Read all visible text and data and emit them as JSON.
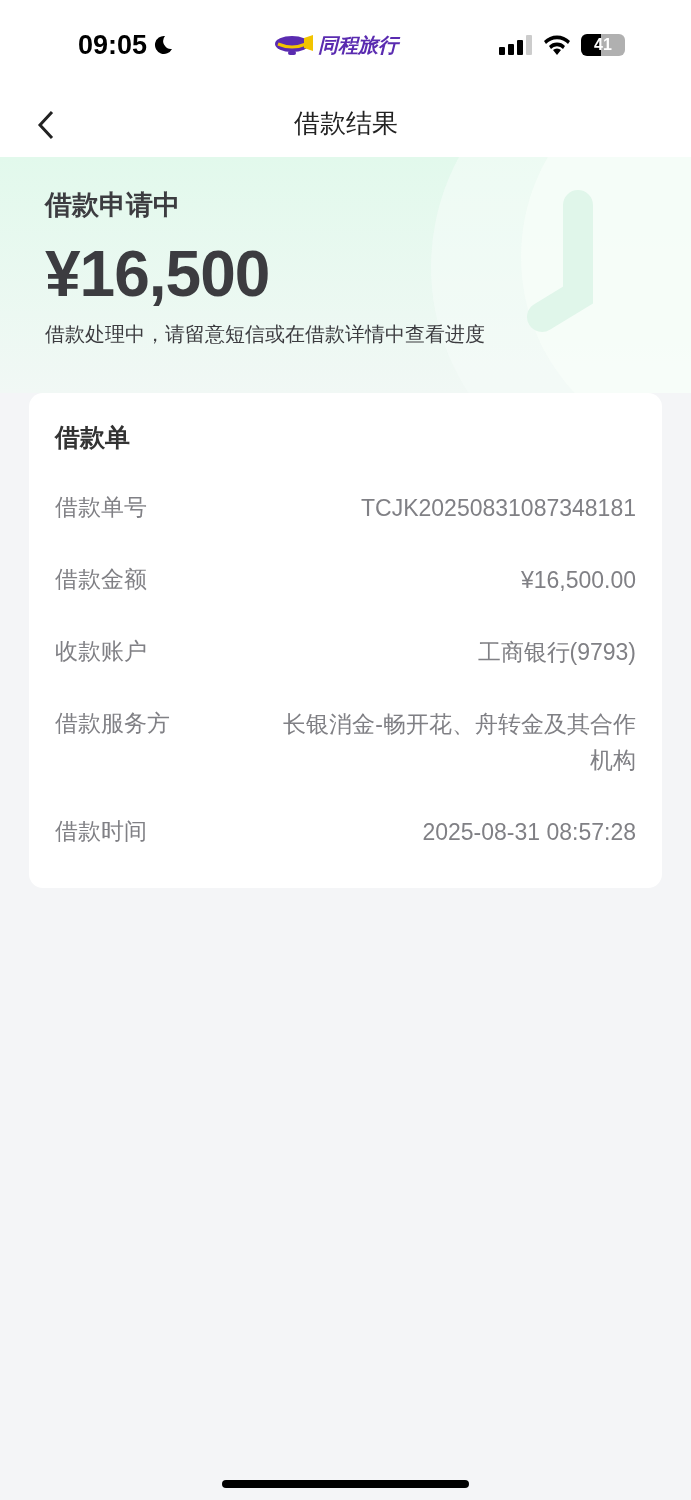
{
  "status_bar": {
    "time": "09:05",
    "app_name": "同程旅行",
    "battery": "41"
  },
  "nav": {
    "title": "借款结果"
  },
  "header": {
    "status": "借款申请中",
    "amount": "¥16,500",
    "note": "借款处理中，请留意短信或在借款详情中查看进度"
  },
  "card": {
    "title": "借款单",
    "rows": [
      {
        "label": "借款单号",
        "value": "TCJK20250831087348181"
      },
      {
        "label": "借款金额",
        "value": "¥16,500.00"
      },
      {
        "label": "收款账户",
        "value": "工商银行(9793)"
      },
      {
        "label": "借款服务方",
        "value": "长银消金-畅开花、舟转金及其合作机构"
      },
      {
        "label": "借款时间",
        "value": "2025-08-31 08:57:28"
      }
    ]
  }
}
